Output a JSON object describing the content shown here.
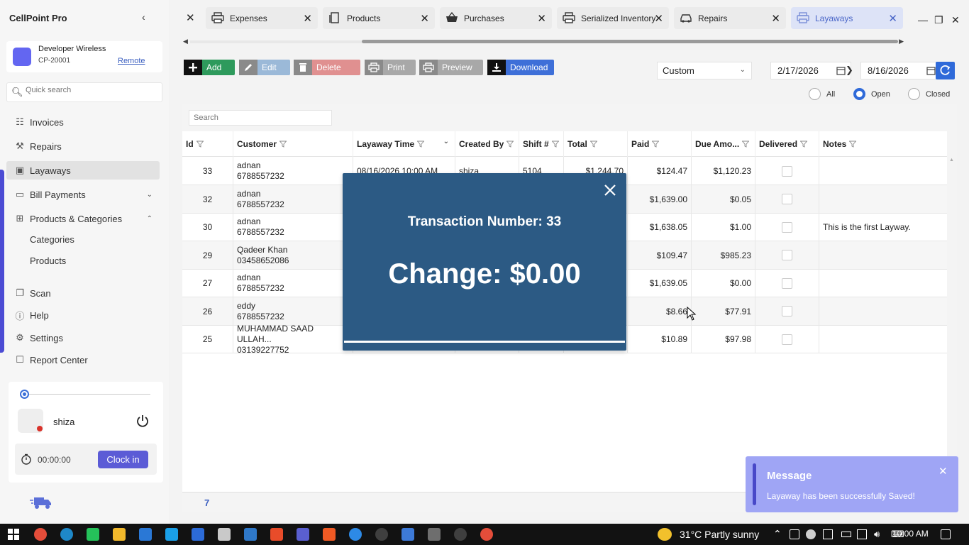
{
  "app": {
    "brand": "CellPoint Pro"
  },
  "company": {
    "name": "Developer Wireless",
    "code": "CP-20001",
    "remote_label": "Remote"
  },
  "sidebar": {
    "search_placeholder": "Quick search",
    "items": [
      {
        "label": "Invoices",
        "icon": "invoice-icon"
      },
      {
        "label": "Repairs",
        "icon": "wrench-icon"
      },
      {
        "label": "Layaways",
        "icon": "layaway-icon"
      },
      {
        "label": "Bill Payments",
        "icon": "bill-icon"
      },
      {
        "label": "Products & Categories",
        "icon": "grid-icon"
      },
      {
        "label": "Categories"
      },
      {
        "label": "Products"
      },
      {
        "label": "Scan",
        "icon": "scan-icon"
      },
      {
        "label": "Help",
        "icon": "help-icon"
      },
      {
        "label": "Settings",
        "icon": "gear-icon"
      },
      {
        "label": "Report Center",
        "icon": "report-icon"
      }
    ]
  },
  "user": {
    "name": "shiza",
    "timer": "00:00:00",
    "clock_in_label": "Clock in"
  },
  "tabs": [
    {
      "label": "Expenses",
      "icon": "printer-icon"
    },
    {
      "label": "Products",
      "icon": "document-icon"
    },
    {
      "label": "Purchases",
      "icon": "basket-icon"
    },
    {
      "label": "Serialized Inventory",
      "icon": "printer-icon"
    },
    {
      "label": "Repairs",
      "icon": "car-icon"
    },
    {
      "label": "Layaways",
      "icon": "printer-icon",
      "active": true
    }
  ],
  "toolbar": {
    "add": "Add",
    "edit": "Edit",
    "delete": "Delete",
    "print": "Print",
    "preview": "Preview",
    "download": "Download",
    "range": "Custom",
    "date_from": "2/17/2026",
    "date_to": "8/16/2026",
    "filters": [
      "All",
      "Open",
      "Closed"
    ],
    "selected_filter": "Open"
  },
  "grid": {
    "search_placeholder": "Search",
    "columns": [
      "Id",
      "Customer",
      "Layaway Time",
      "Created By",
      "Shift #",
      "Total",
      "Paid",
      "Due Amo...",
      "Delivered",
      "Notes"
    ],
    "rows": [
      {
        "id": "33",
        "customer": "adnan",
        "phone": "6788557232",
        "time": "08/16/2026 10:00 AM",
        "created_by": "shiza",
        "shift": "5104",
        "total": "$1,244.70",
        "paid": "$124.47",
        "due": "$1,120.23",
        "notes": ""
      },
      {
        "id": "32",
        "customer": "adnan",
        "phone": "6788557232",
        "time": "",
        "created_by": "",
        "shift": "",
        "total": "",
        "paid": "$1,639.00",
        "due": "$0.05",
        "notes": ""
      },
      {
        "id": "30",
        "customer": "adnan",
        "phone": "6788557232",
        "time": "",
        "created_by": "",
        "shift": "",
        "total": "",
        "paid": "$1,638.05",
        "due": "$1.00",
        "notes": "This is the first Layway."
      },
      {
        "id": "29",
        "customer": "Qadeer Khan",
        "phone": "03458652086",
        "time": "",
        "created_by": "",
        "shift": "",
        "total": "",
        "paid": "$109.47",
        "due": "$985.23",
        "notes": ""
      },
      {
        "id": "27",
        "customer": "adnan",
        "phone": "6788557232",
        "time": "",
        "created_by": "",
        "shift": "",
        "total": "",
        "paid": "$1,639.05",
        "due": "$0.00",
        "notes": ""
      },
      {
        "id": "26",
        "customer": "eddy",
        "phone": "6788557232",
        "time": "",
        "created_by": "",
        "shift": "",
        "total": "",
        "paid": "$8.66",
        "due": "$77.91",
        "notes": ""
      },
      {
        "id": "25",
        "customer": "MUHAMMAD SAAD ULLAH...",
        "phone": "03139227752",
        "time": "",
        "created_by": "",
        "shift": "",
        "total": "",
        "paid": "$10.89",
        "due": "$97.98",
        "notes": ""
      }
    ],
    "count": "7"
  },
  "modal": {
    "transaction": "Transaction Number: 33",
    "change": "Change: $0.00"
  },
  "toast": {
    "title": "Message",
    "message": "Layaway has been successfully Saved!"
  },
  "taskbar": {
    "weather": "31°C  Partly sunny",
    "time": "10:00 AM"
  },
  "colors": {
    "accent": "#5b5bd6",
    "modal_bg": "#2c5a84",
    "toast_bg": "#9fa5f5",
    "add_green": "#2e9a5c",
    "download_blue": "#3e6fd8"
  }
}
